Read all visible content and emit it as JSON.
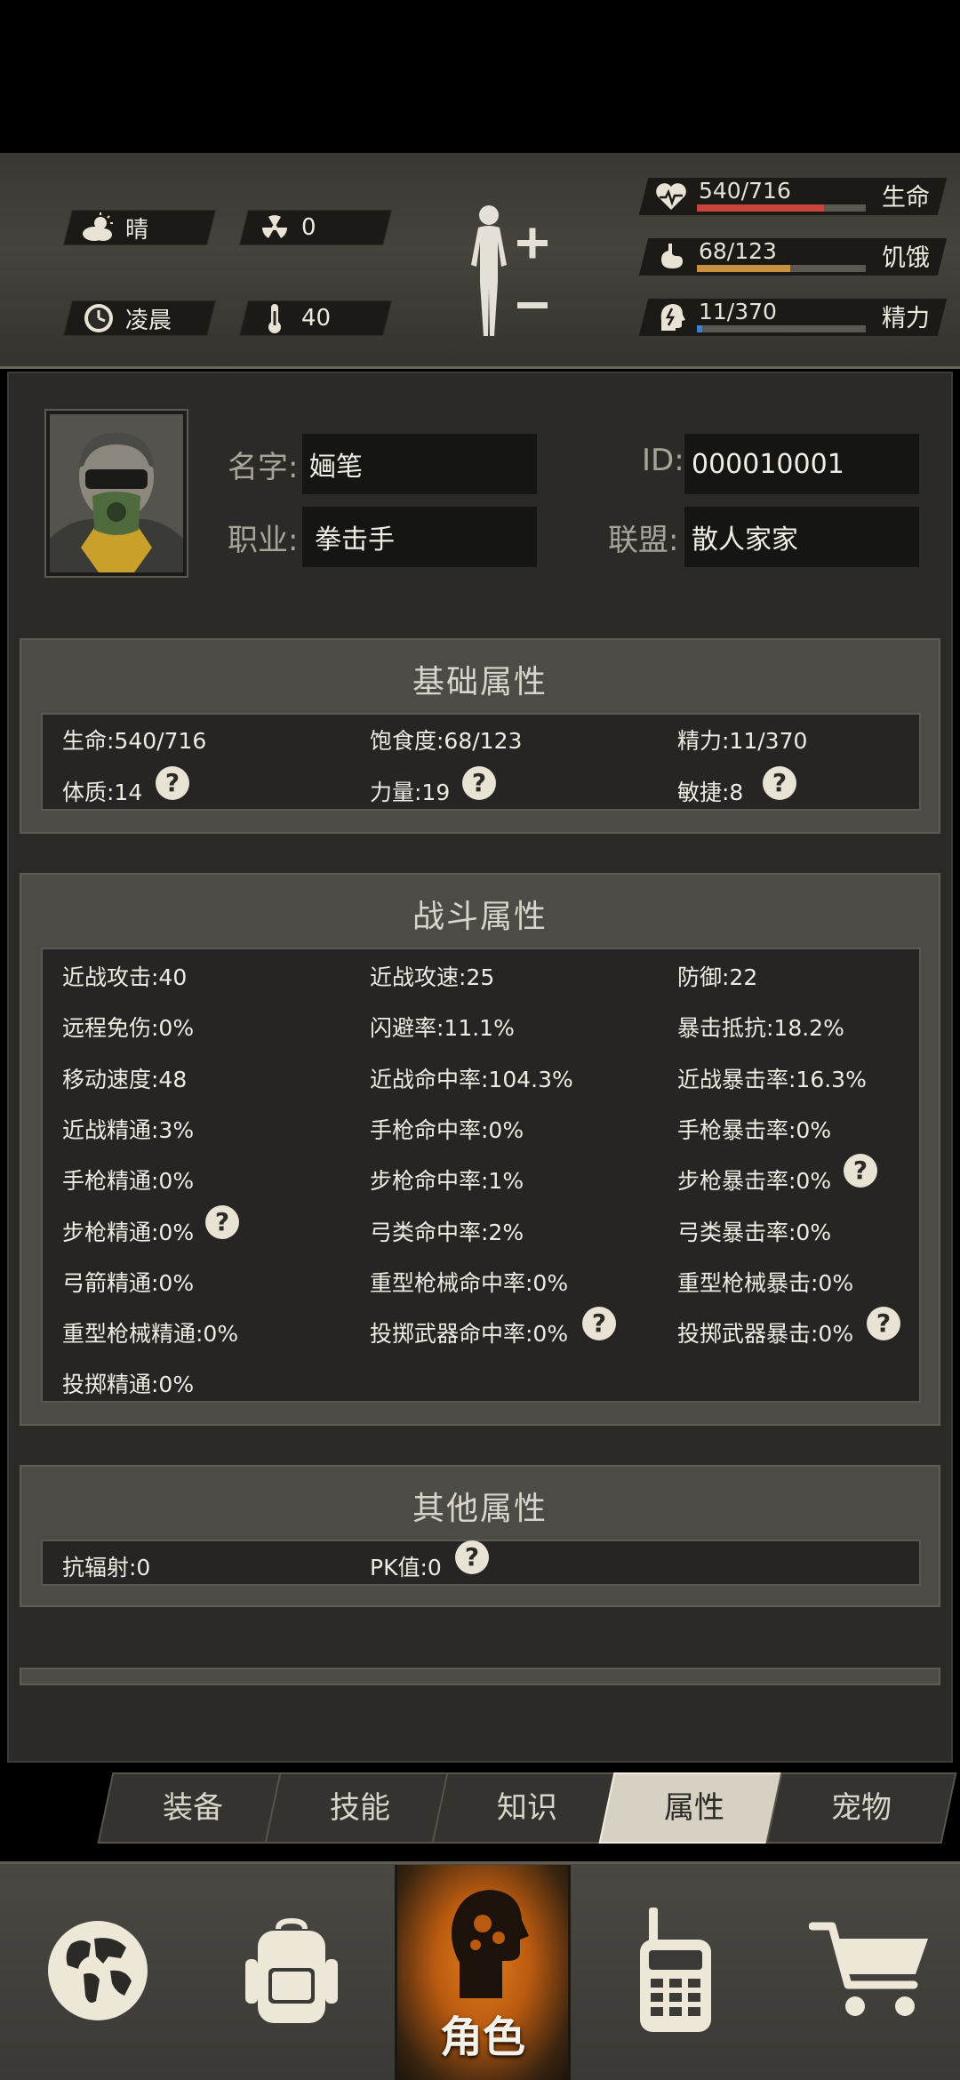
{
  "hud": {
    "weather": "晴",
    "radiation": "0",
    "time_of_day": "凌晨",
    "temperature": "40",
    "vitals": [
      {
        "icon": "heart-icon",
        "value": "540/716",
        "label": "生命",
        "fraction": 0.754,
        "color": "#c9453a"
      },
      {
        "icon": "stomach-icon",
        "value": "68/123",
        "label": "饥饿",
        "fraction": 0.553,
        "color": "#c8913f"
      },
      {
        "icon": "energy-head-icon",
        "value": "11/370",
        "label": "精力",
        "fraction": 0.03,
        "color": "#3d7fd6"
      }
    ]
  },
  "profile": {
    "name_label": "名字:",
    "name": "婳笔",
    "id_label": "ID:",
    "id": "000010001",
    "job_label": "职业:",
    "job": "拳击手",
    "alliance_label": "联盟:",
    "alliance": "散人家家"
  },
  "basic": {
    "title": "基础属性",
    "items": [
      "生命:540/716",
      "饱食度:68/123",
      "精力:11/370",
      "体质:14",
      "力量:19",
      "敏捷:8"
    ]
  },
  "combat": {
    "title": "战斗属性",
    "items": [
      "近战攻击:40",
      "近战攻速:25",
      "防御:22",
      "远程免伤:0%",
      "闪避率:11.1%",
      "暴击抵抗:18.2%",
      "移动速度:48",
      "近战命中率:104.3%",
      "近战暴击率:16.3%",
      "近战精通:3%",
      "手枪命中率:0%",
      "手枪暴击率:0%",
      "手枪精通:0%",
      "步枪命中率:1%",
      "步枪暴击率:0%",
      "步枪精通:0%",
      "弓类命中率:2%",
      "弓类暴击率:0%",
      "弓箭精通:0%",
      "重型枪械命中率:0%",
      "重型枪械暴击:0%",
      "重型枪械精通:0%",
      "投掷武器命中率:0%",
      "投掷武器暴击:0%",
      "投掷精通:0%"
    ]
  },
  "other": {
    "title": "其他属性",
    "items": [
      "抗辐射:0",
      "PK值:0"
    ]
  },
  "help_symbol": "?",
  "tabs": [
    "装备",
    "技能",
    "知识",
    "属性",
    "宠物"
  ],
  "active_tab": "属性",
  "nav": {
    "active_label": "角色"
  }
}
